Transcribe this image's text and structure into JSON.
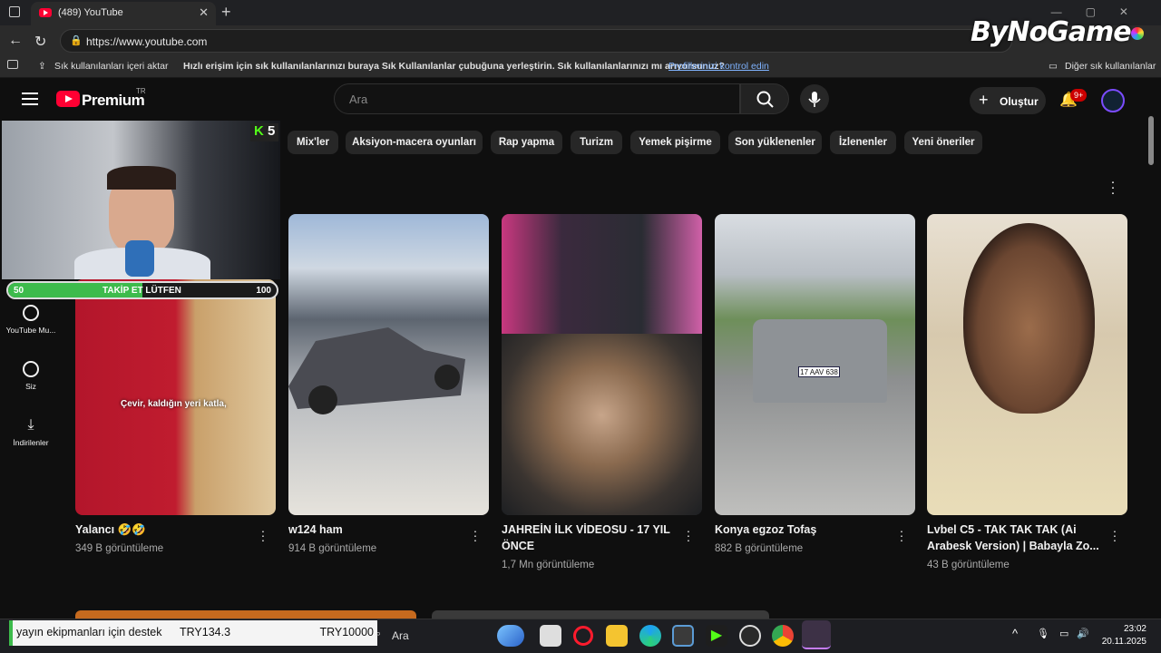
{
  "browser": {
    "tab_title": "(489) YouTube",
    "url": "https://www.youtube.com",
    "bookmarks": {
      "import": "Sık kullanılanları içeri aktar",
      "hint": "Hızlı erişim için sık kullanılanlarınızı buraya Sık Kullanılanlar çubuğuna yerleştirin. Sık kullanılanlarınızı mı arıyorsunuz?",
      "link": "Profillerinizi kontrol edin",
      "other": "Diğer sık kullanılanlar"
    }
  },
  "watermark": "ByNoGame",
  "youtube": {
    "logo_text": "Premium",
    "region": "TR",
    "search_placeholder": "Ara",
    "create_label": "Oluştur",
    "notif_badge": "9+",
    "sidebar": [
      {
        "label": "YouTube Mu...",
        "icon": "music-icon"
      },
      {
        "label": "Siz",
        "icon": "user-icon"
      },
      {
        "label": "İndirilenler",
        "icon": "download-icon"
      }
    ],
    "chips": [
      "Mix'ler",
      "Aksiyon-macera oyunları",
      "Rap yapma",
      "Turizm",
      "Yemek pişirme",
      "Son yüklenenler",
      "İzlenenler",
      "Yeni öneriler"
    ],
    "videos": [
      {
        "title_l1": "Yalancı 🤣🤣",
        "title_l2": "",
        "views": "349 B görüntüleme",
        "caption": "Çevir, kaldığın yeri katla,"
      },
      {
        "title_l1": "w124 ham",
        "title_l2": "",
        "views": "914 B görüntüleme"
      },
      {
        "title_l1": "JAHREİN İLK VİDEOSU - 17 YIL",
        "title_l2": "ÖNCE",
        "views": "1,7 Mn görüntüleme"
      },
      {
        "title_l1": "Konya egzoz Tofaş",
        "title_l2": "",
        "views": "882 B görüntüleme",
        "plate": "17 AAV 638"
      },
      {
        "title_l1": "Lvbel C5 - TAK TAK TAK (Ai",
        "title_l2": "Arabesk Version) | Babayla Zo...",
        "views": "43 B görüntüleme"
      }
    ]
  },
  "stream_overlay": {
    "kick_count": "5",
    "goal_start": "50",
    "goal_label": "TAKİP ET LÜTFEN",
    "goal_end": "100",
    "goal_progress": 0.5,
    "donation_text": "yayın ekipmanları için destek",
    "donation_current": "TRY134.3",
    "donation_goal": "TRY10000"
  },
  "taskbar": {
    "search_label": "Ara",
    "time": "23:02",
    "date": "20.11.2025"
  }
}
